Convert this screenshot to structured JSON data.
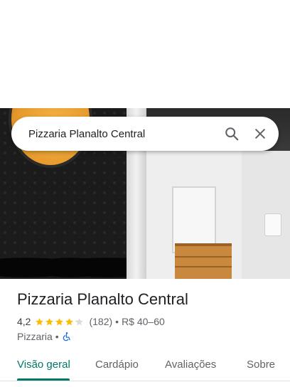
{
  "search": {
    "query": "Pizzaria Planalto Central"
  },
  "place": {
    "name": "Pizzaria Planalto Central",
    "rating": "4,2",
    "rating_stars": 4.2,
    "review_count": "(182)",
    "separator": "•",
    "price_range": "R$ 40–60",
    "category": "Pizzaria",
    "accessibility_icon": "wheelchair-icon"
  },
  "tabs": [
    {
      "label": "Visão geral",
      "active": true
    },
    {
      "label": "Cardápio",
      "active": false
    },
    {
      "label": "Avaliações",
      "active": false
    },
    {
      "label": "Sobre",
      "active": false
    }
  ],
  "colors": {
    "accent": "#00786a",
    "star": "#fbbc04",
    "star_empty": "#dadce0",
    "accessibility": "#1a73e8"
  }
}
